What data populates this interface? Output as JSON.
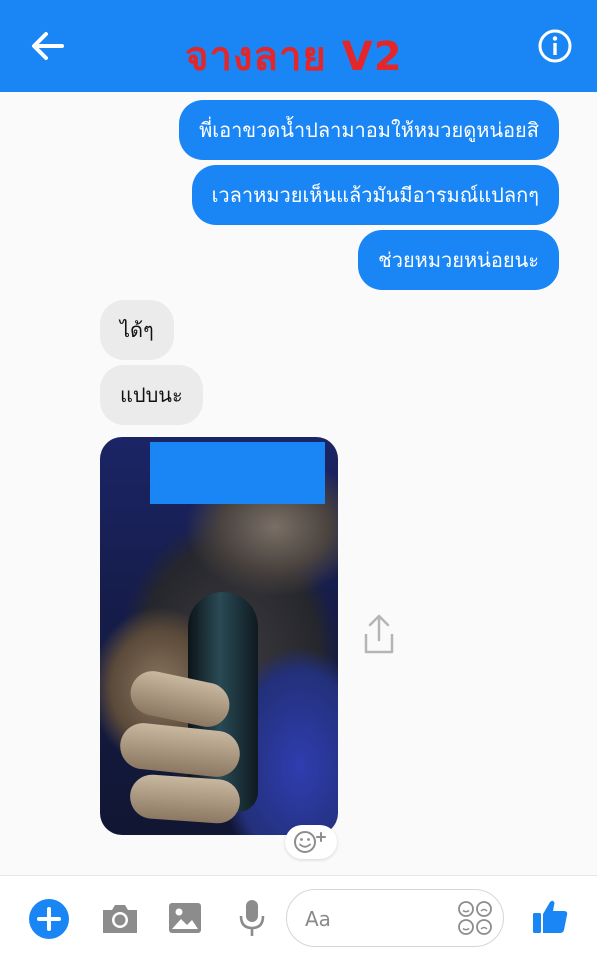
{
  "header": {
    "title": "จางลาย  V2",
    "back_icon": "arrow-left-icon",
    "info_icon": "info-icon",
    "background": "#1a86f5",
    "title_color": "#e3262a"
  },
  "messages": {
    "outgoing": [
      "พี่เอาขวดน้ำปลามาอมให้หมวยดูหน่อยสิ",
      "เวลาหมวยเห็นแล้วมันมีอารมณ์แปลกๆ",
      "ช่วยหมวยหน่อยนะ"
    ],
    "incoming": [
      "ได้ๆ",
      "แปบนะ"
    ],
    "outgoing_color": "#1a86f5",
    "incoming_color": "#ebebeb"
  },
  "photo": {
    "share_icon": "share-icon",
    "reaction_icon": "add-reaction-icon"
  },
  "composer": {
    "placeholder": "Aa",
    "plus_icon": "plus-icon",
    "camera_icon": "camera-icon",
    "image_icon": "image-icon",
    "mic_icon": "microphone-icon",
    "emoji_icon": "emoji-icon",
    "like_icon": "thumbs-up-icon"
  }
}
